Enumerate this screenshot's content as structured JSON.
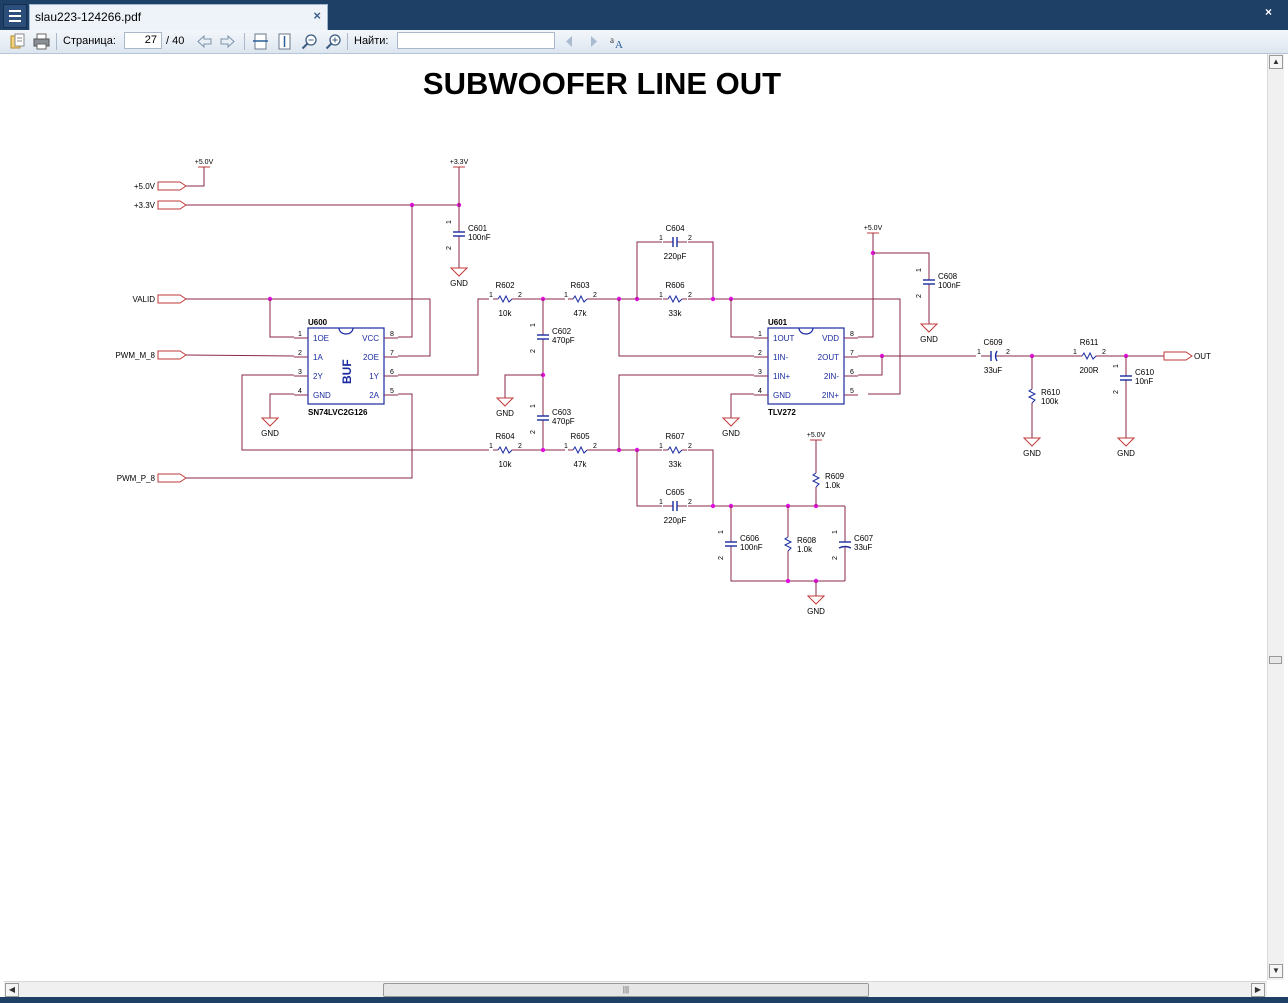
{
  "window": {
    "tab_title": "slau223-124266.pdf",
    "tab_close": "×",
    "close": "×"
  },
  "toolbar": {
    "page_label": "Страница:",
    "page_value": "27",
    "page_total": "/ 40",
    "find_label": "Найти:",
    "find_value": "",
    "icons": [
      "open-icon",
      "print-icon",
      "prev-page-icon",
      "next-page-icon",
      "fit-width-icon",
      "fit-page-icon",
      "zoom-out-icon",
      "zoom-in-icon",
      "find-prev-icon",
      "find-next-icon",
      "match-case-icon"
    ]
  },
  "document": {
    "title": "SUBWOOFER LINE OUT",
    "ports": [
      "+5.0V",
      "+3.3V",
      "VALID",
      "PWM_M_8",
      "PWM_P_8",
      "OUT"
    ],
    "rails": [
      "+5.0V",
      "+3.3V",
      "+3.3V",
      "+5.0V",
      "+5.0V"
    ],
    "ground": "GND",
    "u600": {
      "ref": "U600",
      "part": "SN74LVC2G126",
      "func": "BUF",
      "left_pins": [
        {
          "n": "1",
          "name": "1OE"
        },
        {
          "n": "2",
          "name": "1A"
        },
        {
          "n": "3",
          "name": "2Y"
        },
        {
          "n": "4",
          "name": "GND"
        }
      ],
      "right_pins": [
        {
          "n": "8",
          "name": "VCC"
        },
        {
          "n": "7",
          "name": "2OE"
        },
        {
          "n": "6",
          "name": "1Y"
        },
        {
          "n": "5",
          "name": "2A"
        }
      ]
    },
    "u601": {
      "ref": "U601",
      "part": "TLV272",
      "left_pins": [
        {
          "n": "1",
          "name": "1OUT"
        },
        {
          "n": "2",
          "name": "1IN-"
        },
        {
          "n": "3",
          "name": "1IN+"
        },
        {
          "n": "4",
          "name": "GND"
        }
      ],
      "right_pins": [
        {
          "n": "8",
          "name": "VDD"
        },
        {
          "n": "7",
          "name": "2OUT"
        },
        {
          "n": "6",
          "name": "2IN-"
        },
        {
          "n": "5",
          "name": "2IN+"
        }
      ]
    },
    "components": [
      {
        "ref": "C601",
        "value": "100nF"
      },
      {
        "ref": "R602",
        "value": "10k"
      },
      {
        "ref": "R603",
        "value": "47k"
      },
      {
        "ref": "C602",
        "value": "470pF"
      },
      {
        "ref": "C603",
        "value": "470pF"
      },
      {
        "ref": "R604",
        "value": "10k"
      },
      {
        "ref": "R605",
        "value": "47k"
      },
      {
        "ref": "C604",
        "value": "220pF"
      },
      {
        "ref": "R606",
        "value": "33k"
      },
      {
        "ref": "R607",
        "value": "33k"
      },
      {
        "ref": "C605",
        "value": "220pF"
      },
      {
        "ref": "C608",
        "value": "100nF"
      },
      {
        "ref": "R609",
        "value": "1.0k"
      },
      {
        "ref": "C606",
        "value": "100nF"
      },
      {
        "ref": "R608",
        "value": "1.0k"
      },
      {
        "ref": "C607",
        "value": "33uF"
      },
      {
        "ref": "C609",
        "value": "33uF"
      },
      {
        "ref": "R610",
        "value": "100k"
      },
      {
        "ref": "R611",
        "value": "200R"
      },
      {
        "ref": "C610",
        "value": "10nF"
      }
    ]
  }
}
